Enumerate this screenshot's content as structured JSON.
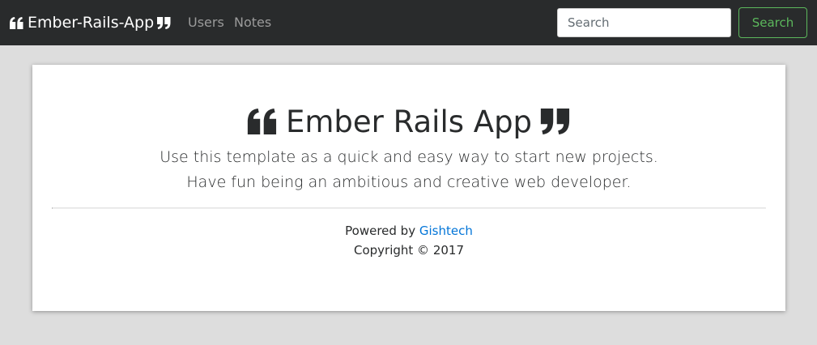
{
  "navbar": {
    "brand": "Ember-Rails-App",
    "links": [
      {
        "label": "Users"
      },
      {
        "label": "Notes"
      }
    ],
    "search": {
      "placeholder": "Search",
      "value": "",
      "button_label": "Search"
    }
  },
  "hero": {
    "title": "Ember Rails App",
    "lead_lines": [
      "Use this template as a quick and easy way to start new projects.",
      "Have fun being an ambitious and creative web developer."
    ]
  },
  "footer": {
    "powered_prefix": "Powered by ",
    "powered_link": "Gishtech",
    "copyright": "Copyright © 2017"
  },
  "icons": {
    "quote_left": "quote-left-icon",
    "quote_right": "quote-right-icon"
  },
  "colors": {
    "navbar_bg": "#292b2c",
    "page_bg": "#dddddd",
    "success": "#5cb85c",
    "link": "#0275d8",
    "text": "#292b2c"
  }
}
